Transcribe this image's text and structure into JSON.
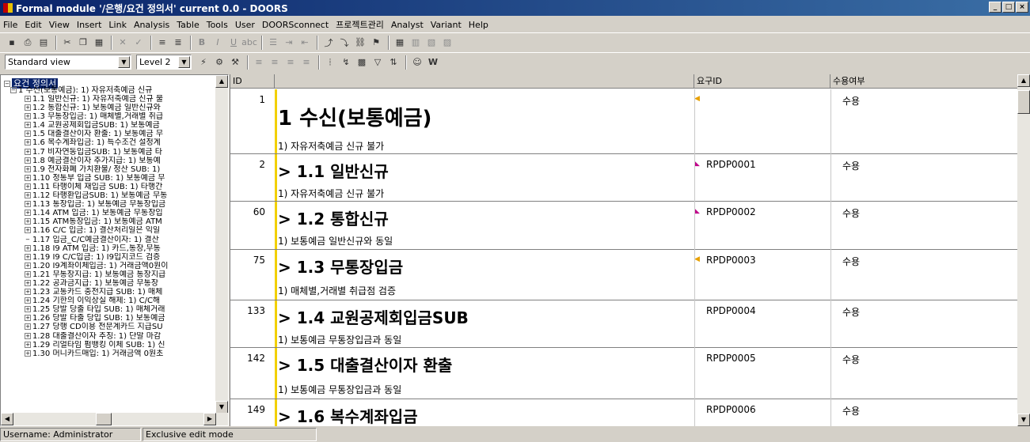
{
  "window": {
    "title": "Formal module '/은행/요건 정의서' current 0.0 - DOORS",
    "buttons": [
      "_",
      "□",
      "×"
    ]
  },
  "menu": [
    "File",
    "Edit",
    "View",
    "Insert",
    "Link",
    "Analysis",
    "Table",
    "Tools",
    "User",
    "DOORSconnect",
    "프로젝트관리",
    "Analyst",
    "Variant",
    "Help"
  ],
  "toolbar": {
    "view_select": "Standard view",
    "level_select": "Level 2"
  },
  "tree": {
    "root": "요건 정의서",
    "top": "1 수신(보통예금): 1) 자유저축예금 신규",
    "items": [
      "1.1 일반신규: 1) 자유저축예금 신규 불",
      "1.2 통합신규: 1) 보통예금 일반신규와",
      "1.3 무통장입금: 1) 매체별,거래별 취급",
      "1.4 교원공제회입금SUB: 1) 보통예금",
      "1.5 대출결산이자 환출: 1) 보통예금 무",
      "1.6 복수계좌입금: 1) 특수조건 설정계",
      "1.7 비자연동입금SUB: 1) 보통예금 타",
      "1.8 예금결산이자 추가지급: 1) 보통예",
      "1.9 전자화폐 가치환불/ 정산 SUB: 1)",
      "1.10 정통부 입금 SUB: 1) 보통예금 무",
      "1.11 타행이체 재입금 SUB: 1) 타행간",
      "1.12 타행환입금SUB: 1) 보통예금 무통",
      "1.13 통장입금: 1) 보통예금 무통장입금",
      "1.14 ATM 입금: 1) 보통예금 무통장입",
      "1.15 ATM통장입금: 1) 보통예금 ATM",
      "1.16 C/C 입금: 1) 결산처리일은 익일",
      "1.17 입금_C/C예금결산이자: 1) 결산",
      "1.18 I9 ATM 입금: 1) 카드,통장,무통",
      "1.19 I9 C/C입금: 1) I9입지코드 검증",
      "1.20 I9계좌이체입금: 1) 거래금액0원이",
      "1.21 무통장지급: 1) 보통예금 통장지급",
      "1.22 공과금지급: 1) 보통예금 무통장",
      "1.23 교통카드 충전지급 SUB: 1) 매체",
      "1.24 기한의 이익상실 해제: 1) C/C해",
      "1.25 당발 당출 타입 SUB: 1) 매체거래",
      "1.26 당발 타출 당입 SUB: 1) 보통예금",
      "1.27 당행 CD이용 전문계카드 지급SU",
      "1.28 대출결산이자 추징: 1) 단말 마감",
      "1.29 리얼타임 펌뱅킹 이체 SUB: 1) 신",
      "1.30 머니카드매입: 1) 거래금액 0원초"
    ]
  },
  "columns": {
    "id": "ID",
    "main": "",
    "req_id": "요구ID",
    "accept": "수용여부"
  },
  "rows": [
    {
      "id": "1",
      "heading": "1 수신(보통예금)",
      "text": "1) 자유저축예금 신규 불가",
      "req_id": "",
      "accept": "수용"
    },
    {
      "id": "2",
      "heading": "> 1.1 일반신규",
      "text": "1) 자유저축예금 신규 불가",
      "req_id": "RPDP0001",
      "accept": "수용"
    },
    {
      "id": "60",
      "heading": "> 1.2 통합신규",
      "text": "1) 보통예금 일반신규와 동일",
      "req_id": "RPDP0002",
      "accept": "수용"
    },
    {
      "id": "75",
      "heading": "> 1.3 무통장입금",
      "text": "1) 매체별,거래별 취급점 검증",
      "req_id": "RPDP0003",
      "accept": "수용"
    },
    {
      "id": "133",
      "heading": "> 1.4 교원공제회입금SUB",
      "text": "1) 보통예금 무통장입금과 동일",
      "req_id": "RPDP0004",
      "accept": "수용"
    },
    {
      "id": "142",
      "heading": "> 1.5 대출결산이자 환출",
      "text": "1) 보통예금 무통장입금과 동일",
      "req_id": "RPDP0005",
      "accept": "수용"
    },
    {
      "id": "149",
      "heading": "> 1.6 복수계좌입금",
      "text": "",
      "req_id": "RPDP0006",
      "accept": "수용"
    }
  ],
  "status": {
    "user": "Username: Administrator",
    "mode": "Exclusive edit mode"
  }
}
